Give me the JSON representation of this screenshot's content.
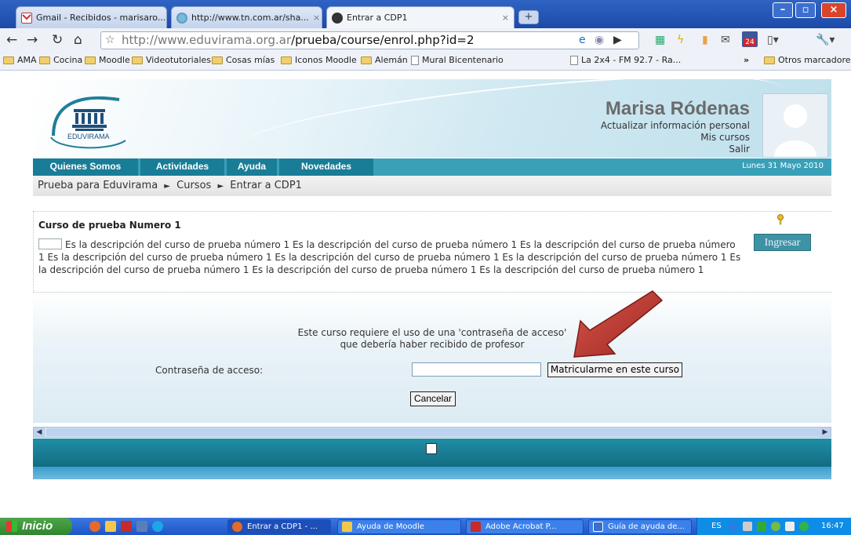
{
  "browser": {
    "tabs": [
      {
        "label": "Gmail - Recibidos - marisaro...",
        "active": false
      },
      {
        "label": "http://www.tn.com.ar/sha...",
        "active": false
      },
      {
        "label": "Entrar a CDP1",
        "active": true
      }
    ],
    "new_tab": "+",
    "url_host": "http://www.eduvirama.org.ar",
    "url_path": "/prueba/course/enrol.php?id=2",
    "bookmarks": [
      {
        "label": "AMA",
        "icon": "folder-icon"
      },
      {
        "label": "Cocina",
        "icon": "folder-icon"
      },
      {
        "label": "Moodle",
        "icon": "folder-icon"
      },
      {
        "label": "Videotutoriales",
        "icon": "folder-icon"
      },
      {
        "label": "Cosas mías",
        "icon": "folder-icon"
      },
      {
        "label": "Iconos Moodle",
        "icon": "folder-icon"
      },
      {
        "label": "Alemán",
        "icon": "folder-icon"
      },
      {
        "label": "Mural Bicentenario",
        "icon": "page-icon"
      },
      {
        "label": "La 2x4 - FM 92.7 - Ra...",
        "icon": "page-icon"
      }
    ],
    "bookmarks_more": "»",
    "other_bookmarks": "Otros marcadores",
    "badge_count": "24"
  },
  "site": {
    "logo_text": "EDUVIRAMA",
    "user_name": "Marisa Ródenas",
    "user_links": [
      "Actualizar información personal",
      "Mis cursos",
      "Salir"
    ],
    "nav": [
      "Quienes Somos",
      "Actividades",
      "Ayuda",
      "Novedades"
    ],
    "date": "Lunes 31 Mayo 2010",
    "breadcrumb": [
      "Prueba para Eduvirama",
      "Cursos",
      "Entrar a CDP1"
    ],
    "breadcrumb_sep": "►",
    "course": {
      "title": "Curso de prueba Numero 1",
      "description": "Es la descripción del curso de prueba número 1 Es la descripción del curso de prueba número 1 Es la descripción del curso de prueba número 1 Es la descripción del curso de prueba número 1 Es la descripción del curso de prueba número 1 Es la descripción del curso de prueba número 1 Es la descripción del curso de prueba número 1 Es la descripción del curso de prueba número 1 Es la descripción del curso de prueba número 1",
      "enter_label": "Ingresar"
    },
    "enrol": {
      "notice_line1": "Este curso requiere el uso de una 'contraseña de acceso'",
      "notice_line2": "que debería haber recibido de profesor",
      "password_label": "Contraseña de acceso:",
      "password_value": "",
      "enrol_button": "Matricularme en este curso",
      "cancel_button": "Cancelar"
    }
  },
  "taskbar": {
    "start": "Inicio",
    "tasks": [
      "Entrar a CDP1 - ...",
      "Ayuda de Moodle",
      "Adobe Acrobat P...",
      "Guía de ayuda de..."
    ],
    "lang": "ES",
    "time": "16:47"
  },
  "colors": {
    "accent_teal": "#1a7d97",
    "arrow_red": "#b8322b",
    "taskbar_blue": "#245edb"
  }
}
